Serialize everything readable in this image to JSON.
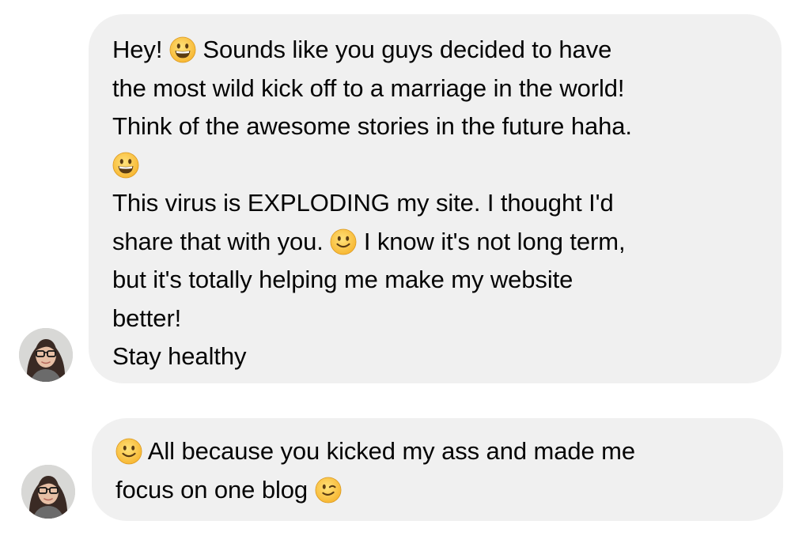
{
  "messages": [
    {
      "lines": [
        {
          "before": "Hey! ",
          "emoji": "grinning-face-icon",
          "after": " Sounds like you guys decided to have"
        },
        {
          "text": "the most wild kick off to a marriage in the world!"
        },
        {
          "text": "Think of the awesome stories in the future haha."
        },
        {
          "emoji": "grinning-face-icon"
        },
        {
          "text": "This virus is EXPLODING my site. I thought I'd"
        },
        {
          "before": "share that with you. ",
          "emoji": "slightly-smiling-face-icon",
          "after": " I know it's not long term,"
        },
        {
          "text": "but it's totally helping me make my website"
        },
        {
          "text": "better!"
        },
        {
          "text": "Stay healthy"
        }
      ]
    },
    {
      "lines": [
        {
          "before": "",
          "emoji": "slightly-smiling-face-icon",
          "after": " All because you kicked my ass and made me"
        },
        {
          "before": "focus on one blog ",
          "emoji": "winking-face-icon",
          "after": ""
        }
      ]
    }
  ],
  "colors": {
    "bubble_background": "#f0f0f0",
    "text": "#050505",
    "emoji_yellow": "#ffcc4d"
  },
  "icons": [
    "grinning-face-icon",
    "slightly-smiling-face-icon",
    "winking-face-icon",
    "avatar"
  ]
}
